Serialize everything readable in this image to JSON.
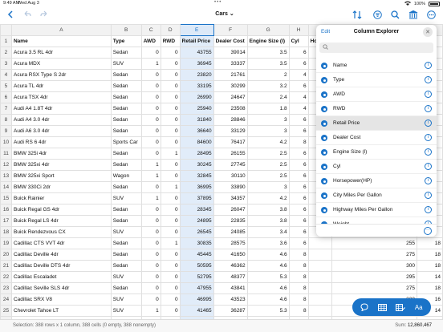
{
  "status_bar": {
    "time": "9:49 AM",
    "date": "Wed Aug 3",
    "battery": "100%"
  },
  "toolbar": {
    "title": "Cars",
    "title_chevron": "chevron-down-icon",
    "left_icons": [
      "back-chevron-icon",
      "undo-icon",
      "redo-icon"
    ],
    "right_icons": [
      "sort-icon",
      "filter-icon",
      "search-icon",
      "library-icon",
      "more-icon"
    ]
  },
  "sheet": {
    "column_letters": [
      "A",
      "B",
      "C",
      "D",
      "E",
      "F",
      "G",
      "H",
      "I"
    ],
    "selected_column": "E",
    "headers": [
      "Name",
      "Type",
      "AWD",
      "RWD",
      "Retail Price",
      "Dealer Cost",
      "Engine Size (l)",
      "Cyl",
      "Ho"
    ],
    "rows": [
      {
        "n": "2",
        "name": "Acura 3.5 RL 4dr",
        "type": "Sedan",
        "awd": "0",
        "rwd": "0",
        "price": "43755",
        "cost": "39014",
        "eng": "3.5",
        "cyl": "6",
        "hp": "",
        "extra": ""
      },
      {
        "n": "3",
        "name": "Acura MDX",
        "type": "SUV",
        "awd": "1",
        "rwd": "0",
        "price": "36945",
        "cost": "33337",
        "eng": "3.5",
        "cyl": "6",
        "hp": "",
        "extra": ""
      },
      {
        "n": "4",
        "name": "Acura RSX Type S 2dr",
        "type": "Sedan",
        "awd": "0",
        "rwd": "0",
        "price": "23820",
        "cost": "21761",
        "eng": "2",
        "cyl": "4",
        "hp": "",
        "extra": ""
      },
      {
        "n": "5",
        "name": "Acura TL 4dr",
        "type": "Sedan",
        "awd": "0",
        "rwd": "0",
        "price": "33195",
        "cost": "30299",
        "eng": "3.2",
        "cyl": "6",
        "hp": "",
        "extra": ""
      },
      {
        "n": "6",
        "name": "Acura TSX 4dr",
        "type": "Sedan",
        "awd": "0",
        "rwd": "0",
        "price": "26990",
        "cost": "24647",
        "eng": "2.4",
        "cyl": "4",
        "hp": "",
        "extra": ""
      },
      {
        "n": "7",
        "name": "Audi A4 1.8T 4dr",
        "type": "Sedan",
        "awd": "0",
        "rwd": "0",
        "price": "25940",
        "cost": "23508",
        "eng": "1.8",
        "cyl": "4",
        "hp": "",
        "extra": ""
      },
      {
        "n": "8",
        "name": "Audi A4 3.0 4dr",
        "type": "Sedan",
        "awd": "0",
        "rwd": "0",
        "price": "31840",
        "cost": "28846",
        "eng": "3",
        "cyl": "6",
        "hp": "",
        "extra": ""
      },
      {
        "n": "9",
        "name": "Audi A6 3.0 4dr",
        "type": "Sedan",
        "awd": "0",
        "rwd": "0",
        "price": "36640",
        "cost": "33129",
        "eng": "3",
        "cyl": "6",
        "hp": "",
        "extra": ""
      },
      {
        "n": "10",
        "name": "Audi RS 6 4dr",
        "type": "Sports Car",
        "awd": "0",
        "rwd": "0",
        "price": "84600",
        "cost": "76417",
        "eng": "4.2",
        "cyl": "8",
        "hp": "",
        "extra": ""
      },
      {
        "n": "11",
        "name": "BMW 325i 4dr",
        "type": "Sedan",
        "awd": "0",
        "rwd": "1",
        "price": "28495",
        "cost": "26155",
        "eng": "2.5",
        "cyl": "6",
        "hp": "",
        "extra": ""
      },
      {
        "n": "12",
        "name": "BMW 325xi 4dr",
        "type": "Sedan",
        "awd": "1",
        "rwd": "0",
        "price": "30245",
        "cost": "27745",
        "eng": "2.5",
        "cyl": "6",
        "hp": "",
        "extra": ""
      },
      {
        "n": "13",
        "name": "BMW 325xi Sport",
        "type": "Wagon",
        "awd": "1",
        "rwd": "0",
        "price": "32845",
        "cost": "30110",
        "eng": "2.5",
        "cyl": "6",
        "hp": "",
        "extra": ""
      },
      {
        "n": "14",
        "name": "BMW 330Ci 2dr",
        "type": "Sedan",
        "awd": "0",
        "rwd": "1",
        "price": "36995",
        "cost": "33890",
        "eng": "3",
        "cyl": "6",
        "hp": "",
        "extra": ""
      },
      {
        "n": "15",
        "name": "Buick Rainier",
        "type": "SUV",
        "awd": "1",
        "rwd": "0",
        "price": "37895",
        "cost": "34357",
        "eng": "4.2",
        "cyl": "6",
        "hp": "",
        "extra": ""
      },
      {
        "n": "16",
        "name": "Buick Regal GS 4dr",
        "type": "Sedan",
        "awd": "0",
        "rwd": "0",
        "price": "28345",
        "cost": "26047",
        "eng": "3.8",
        "cyl": "6",
        "hp": "",
        "extra": ""
      },
      {
        "n": "17",
        "name": "Buick Regal LS 4dr",
        "type": "Sedan",
        "awd": "0",
        "rwd": "0",
        "price": "24895",
        "cost": "22835",
        "eng": "3.8",
        "cyl": "6",
        "hp": "",
        "extra": ""
      },
      {
        "n": "18",
        "name": "Buick Rendezvous CX",
        "type": "SUV",
        "awd": "0",
        "rwd": "0",
        "price": "26545",
        "cost": "24085",
        "eng": "3.4",
        "cyl": "6",
        "hp": "",
        "extra": ""
      },
      {
        "n": "19",
        "name": "Cadillac CTS VVT 4dr",
        "type": "Sedan",
        "awd": "0",
        "rwd": "1",
        "price": "30835",
        "cost": "28575",
        "eng": "3.6",
        "cyl": "6",
        "hp": "255",
        "extra": "18"
      },
      {
        "n": "20",
        "name": "Cadillac Deville 4dr",
        "type": "Sedan",
        "awd": "0",
        "rwd": "0",
        "price": "45445",
        "cost": "41650",
        "eng": "4.6",
        "cyl": "8",
        "hp": "275",
        "extra": "18"
      },
      {
        "n": "21",
        "name": "Cadillac Deville DTS 4dr",
        "type": "Sedan",
        "awd": "0",
        "rwd": "0",
        "price": "50595",
        "cost": "46362",
        "eng": "4.6",
        "cyl": "8",
        "hp": "300",
        "extra": "18"
      },
      {
        "n": "22",
        "name": "Cadillac Escaladet",
        "type": "SUV",
        "awd": "0",
        "rwd": "0",
        "price": "52795",
        "cost": "48377",
        "eng": "5.3",
        "cyl": "8",
        "hp": "295",
        "extra": "14"
      },
      {
        "n": "23",
        "name": "Cadillac Seville SLS 4dr",
        "type": "Sedan",
        "awd": "0",
        "rwd": "0",
        "price": "47955",
        "cost": "43841",
        "eng": "4.6",
        "cyl": "8",
        "hp": "275",
        "extra": "18"
      },
      {
        "n": "24",
        "name": "Cadillac SRX V8",
        "type": "SUV",
        "awd": "0",
        "rwd": "0",
        "price": "46995",
        "cost": "43523",
        "eng": "4.6",
        "cyl": "8",
        "hp": "320",
        "extra": "16"
      },
      {
        "n": "25",
        "name": "Chevrolet Tahoe LT",
        "type": "SUV",
        "awd": "1",
        "rwd": "0",
        "price": "41465",
        "cost": "36287",
        "eng": "5.3",
        "cyl": "8",
        "hp": "295",
        "extra": "14"
      },
      {
        "n": "26",
        "name": "",
        "type": "",
        "awd": "",
        "rwd": "",
        "price": "",
        "cost": "",
        "eng": "",
        "cyl": "",
        "hp": "",
        "extra": ""
      }
    ]
  },
  "statusline": {
    "selection": "Selection: 388 rows x 1 column, 388 cells (0 empty, 388 nonempty)",
    "sum_label": "Sum: ",
    "sum_value": "12,860,467"
  },
  "column_explorer": {
    "edit_label": "Edit",
    "title": "Column Explorer",
    "search_placeholder": "",
    "selected_item": "Retail Price",
    "items": [
      "Name",
      "Type",
      "AWD",
      "RWD",
      "Retail Price",
      "Dealer Cost",
      "Engine Size (l)",
      "Cyl",
      "Horsepower(HP)",
      "City Miles Per Gallon",
      "Highway Miles Per Gallon",
      "Weight"
    ]
  },
  "fab": {
    "buttons": [
      "comment-icon",
      "table-icon",
      "table-edit-icon",
      "text-format-icon"
    ],
    "text_label": "Aa"
  },
  "colors": {
    "accent": "#1a73c8",
    "selected_cell": "#e1ecf9",
    "header_bg": "#f2f2f2"
  }
}
